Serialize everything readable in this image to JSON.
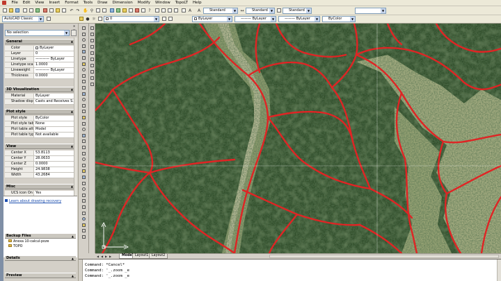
{
  "menu": [
    "File",
    "Edit",
    "View",
    "Insert",
    "Format",
    "Tools",
    "Draw",
    "Dimension",
    "Modify",
    "Window",
    "TopoLT",
    "Help"
  ],
  "toolbar": {
    "text_style": "Standard",
    "dim_style": "Standard",
    "table_style": "Standard",
    "layer_value": "0",
    "color": "ByLayer",
    "linetype": "ByLayer",
    "lineweight": "ByLayer",
    "plot_style": "ByColor",
    "workspace": "AutoCAD Classic"
  },
  "properties": {
    "selection": "No selection",
    "sections": [
      {
        "title": "General",
        "rows": [
          {
            "label": "Color",
            "value": "ByLayer",
            "swatch": true
          },
          {
            "label": "Layer",
            "value": "0"
          },
          {
            "label": "Linetype",
            "value": "———— ByLayer"
          },
          {
            "label": "Linetype scale",
            "value": "1.0000"
          },
          {
            "label": "Lineweight",
            "value": "———— ByLayer"
          },
          {
            "label": "Thickness",
            "value": "0.0000"
          }
        ]
      },
      {
        "title": "3D Visualization",
        "rows": [
          {
            "label": "Material",
            "value": "ByLayer"
          },
          {
            "label": "Shadow display",
            "value": "Casts and Receives S..."
          }
        ]
      },
      {
        "title": "Plot style",
        "rows": [
          {
            "label": "Plot style",
            "value": "ByColor"
          },
          {
            "label": "Plot style table",
            "value": "None"
          },
          {
            "label": "Plot table atta...",
            "value": "Model"
          },
          {
            "label": "Plot table type",
            "value": "Not available"
          }
        ]
      },
      {
        "title": "View",
        "rows": [
          {
            "label": "Center X",
            "value": "53.8113"
          },
          {
            "label": "Center Y",
            "value": "28.0633"
          },
          {
            "label": "Center Z",
            "value": "0.0000"
          },
          {
            "label": "Height",
            "value": "24.9838"
          },
          {
            "label": "Width",
            "value": "43.2684"
          }
        ]
      },
      {
        "title": "Misc",
        "rows": [
          {
            "label": "UCS icon On",
            "value": "Yes"
          }
        ]
      }
    ]
  },
  "recovery": {
    "link": "Learn about drawing recovery",
    "backup_title": "Backup Files",
    "files": [
      "Anexa 10-calcul-poze",
      "TOPO"
    ],
    "details_title": "Details",
    "preview_title": "Preview"
  },
  "tabs": [
    "Model",
    "Layout1",
    "Layout2"
  ],
  "command_lines": [
    "Command: *Cancel*",
    "Command: '_.zoom _e",
    "Command: '_.zoom _e"
  ],
  "colors": {
    "boundary": "#e02424",
    "river": "#a9ad82",
    "forest": "#2f4a2a"
  }
}
